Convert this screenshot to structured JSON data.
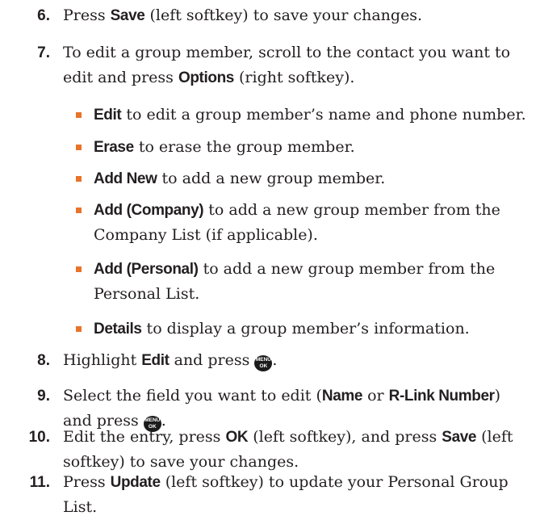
{
  "steps": [
    {
      "num": "6.",
      "parts": [
        {
          "t": "Press ",
          "b": false
        },
        {
          "t": "Save",
          "b": true
        },
        {
          "t": " (left softkey) to save your changes.",
          "b": false
        }
      ]
    },
    {
      "num": "7.",
      "parts": [
        {
          "t": "To edit a group member, scroll to the contact you want to edit and press ",
          "b": false
        },
        {
          "t": "Options",
          "b": true
        },
        {
          "t": " (right softkey).",
          "b": false
        }
      ]
    },
    {
      "num": "8.",
      "parts": [
        {
          "t": "Highlight ",
          "b": false
        },
        {
          "t": "Edit",
          "b": true
        },
        {
          "t": " and press ",
          "b": false
        },
        {
          "icon": "menu-ok"
        },
        {
          "t": ".",
          "b": false
        }
      ]
    },
    {
      "num": "9.",
      "parts": [
        {
          "t": "Select the field you want to edit (",
          "b": false
        },
        {
          "t": "Name",
          "b": true
        },
        {
          "t": " or ",
          "b": false
        },
        {
          "t": "R-Link Number",
          "b": true
        },
        {
          "t": ") and press ",
          "b": false
        },
        {
          "icon": "menu-ok"
        },
        {
          "t": ".",
          "b": false
        }
      ]
    },
    {
      "num": "10.",
      "parts": [
        {
          "t": "Edit the entry, press ",
          "b": false
        },
        {
          "t": "OK",
          "b": true
        },
        {
          "t": " (left softkey), and press ",
          "b": false
        },
        {
          "t": "Save",
          "b": true
        },
        {
          "t": " (left softkey) to save your changes.",
          "b": false
        }
      ]
    },
    {
      "num": "11.",
      "parts": [
        {
          "t": "Press ",
          "b": false
        },
        {
          "t": "Update",
          "b": true
        },
        {
          "t": " (left softkey) to update your Personal Group List.",
          "b": false
        }
      ]
    }
  ],
  "bullets": [
    [
      {
        "t": "Edit",
        "b": true
      },
      {
        "t": " to edit a group member’s name and phone number.",
        "b": false
      }
    ],
    [
      {
        "t": "Erase",
        "b": true
      },
      {
        "t": " to erase the group member.",
        "b": false
      }
    ],
    [
      {
        "t": "Add New",
        "b": true
      },
      {
        "t": " to add a new group member.",
        "b": false
      }
    ],
    [
      {
        "t": "Add (Company)",
        "b": true
      },
      {
        "t": " to add a new group member from the Company List (if applicable).",
        "b": false
      }
    ],
    [
      {
        "t": "Add (Personal)",
        "b": true
      },
      {
        "t": " to add a new group member from the Personal List.",
        "b": false
      }
    ],
    [
      {
        "t": "Details",
        "b": true
      },
      {
        "t": " to display a group member’s information.",
        "b": false
      }
    ]
  ],
  "icons": {
    "menu_ok": {
      "line1": "MENU",
      "line2": "OK",
      "name": "menu-ok-key-icon"
    }
  },
  "colors": {
    "bullet": "#e8732a",
    "text": "#231f20"
  }
}
